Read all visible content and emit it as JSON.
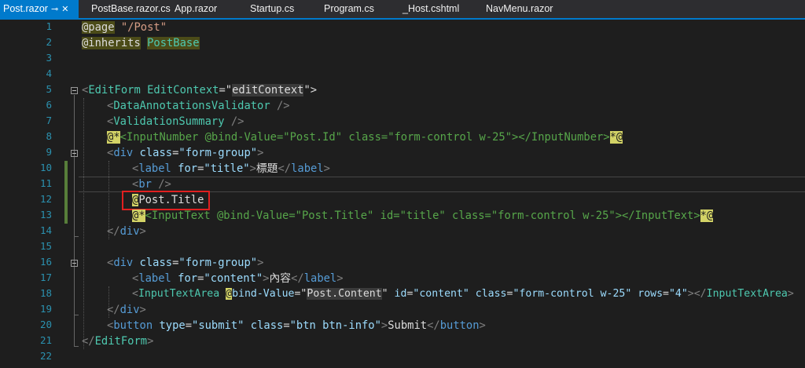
{
  "tabs": [
    {
      "label": "Post.razor",
      "active": true
    },
    {
      "label": "PostBase.razor.cs"
    },
    {
      "label": "App.razor"
    },
    {
      "label": "Startup.cs"
    },
    {
      "label": "Program.cs"
    },
    {
      "label": "_Host.cshtml"
    },
    {
      "label": "NavMenu.razor"
    }
  ],
  "icons": {
    "pin": "pin-icon",
    "close": "close-icon"
  },
  "line_numbers": [
    "1",
    "2",
    "3",
    "4",
    "5",
    "6",
    "7",
    "8",
    "9",
    "10",
    "11",
    "12",
    "13",
    "14",
    "15",
    "16",
    "17",
    "18",
    "19",
    "20",
    "21",
    "22"
  ],
  "code": {
    "l1": {
      "dir": "@page",
      "str": "\"/Post\""
    },
    "l2": {
      "dir": "@inherits",
      "type": "PostBase"
    },
    "l5": {
      "open": "<",
      "tag": "EditForm",
      "attr": "EditContext",
      "eq": "=\"",
      "val": "editContext",
      "close": "\">"
    },
    "l6": {
      "open": "<",
      "tag": "DataAnnotationsValidator",
      "close": " />"
    },
    "l7": {
      "open": "<",
      "tag": "ValidationSummary",
      "close": " />"
    },
    "l8": {
      "at1": "@*",
      "comment": "<InputNumber @bind-Value=\"Post.Id\" class=\"form-control w-25\"></InputNumber>",
      "at2": "*@"
    },
    "l9": {
      "open": "<",
      "tag": "div",
      "attr": " class",
      "eq": "=",
      "val": "\"form-group\"",
      "close": ">"
    },
    "l10": {
      "open": "<",
      "tag": "label",
      "attr": " for",
      "eq": "=",
      "val": "\"title\"",
      "gt": ">",
      "text": "標題",
      "endopen": "</",
      "endtag": "label",
      "endclose": ">"
    },
    "l11": {
      "open": "<",
      "tag": "br",
      "close": " />"
    },
    "l12": {
      "at": "@",
      "text": "Post.Title"
    },
    "l13": {
      "at1": "@*",
      "comment": "<InputText @bind-Value=\"Post.Title\" id=\"title\" class=\"form-control w-25\"></InputText>",
      "at2": "*@"
    },
    "l14": {
      "open": "</",
      "tag": "div",
      "close": ">"
    },
    "l16": {
      "open": "<",
      "tag": "div",
      "attr": " class",
      "eq": "=",
      "val": "\"form-group\"",
      "close": ">"
    },
    "l17": {
      "open": "<",
      "tag": "label",
      "attr": " for",
      "eq": "=",
      "val": "\"content\"",
      "gt": ">",
      "text": "內容",
      "endopen": "</",
      "endtag": "label",
      "endclose": ">"
    },
    "l18": {
      "open": "<",
      "tag": "InputTextArea",
      "sp": " ",
      "at": "@",
      "attr1": "bind-Value",
      "eq1": "=\"",
      "val1": "Post.Content",
      "q1": "\"",
      "attr2": " id",
      "eq2": "=",
      "val2": "\"content\"",
      "attr3": " class",
      "eq3": "=",
      "val3": "\"form-control w-25\"",
      "attr4": " rows",
      "eq4": "=",
      "val4": "\"4\"",
      "mid": "></",
      "endtag": "InputTextArea",
      "endclose": ">"
    },
    "l19": {
      "open": "</",
      "tag": "div",
      "close": ">"
    },
    "l20": {
      "open": "<",
      "tag": "button",
      "attr1": " type",
      "eq1": "=",
      "val1": "\"submit\"",
      "attr2": " class",
      "eq2": "=",
      "val2": "\"btn btn-info\"",
      "gt": ">",
      "text": "Submit",
      "endopen": "</",
      "endtag": "button",
      "endclose": ">"
    },
    "l21": {
      "open": "</",
      "tag": "EditForm",
      "close": ">"
    }
  },
  "colors": {
    "accent": "#007acc",
    "highlight_box": "#e02020",
    "change_bar": "#577e3a"
  }
}
